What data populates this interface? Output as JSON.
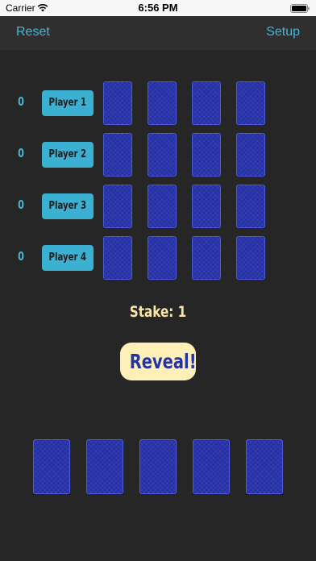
{
  "status": {
    "carrier": "Carrier",
    "time": "6:56 PM",
    "wifi_icon": "wifi-icon",
    "battery_icon": "battery-icon"
  },
  "nav": {
    "left_label": "Reset",
    "right_label": "Setup"
  },
  "players": [
    {
      "score": "0",
      "name": "Player 1"
    },
    {
      "score": "0",
      "name": "Player 2"
    },
    {
      "score": "0",
      "name": "Player 3"
    },
    {
      "score": "0",
      "name": "Player 4"
    }
  ],
  "stake_label": "Stake: 1",
  "reveal_label": "Reveal!",
  "colors": {
    "background": "#262626",
    "accent": "#41b8d9",
    "card_back": "#2530a6",
    "reveal_bg": "#fff0b8",
    "stake_text": "#fbe6a6"
  }
}
